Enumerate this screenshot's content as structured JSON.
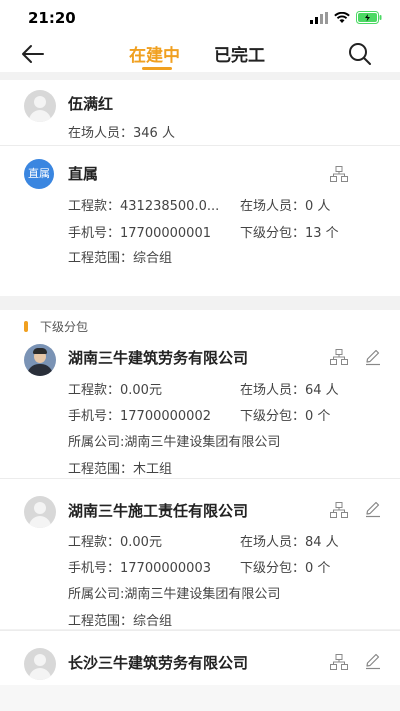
{
  "status_bar": {
    "time": "21:20",
    "icons": [
      "signal-icon",
      "wifi-icon",
      "battery-charging-icon"
    ],
    "battery_color": "#4cd964"
  },
  "nav": {
    "back_icon": "back-arrow-icon",
    "tabs": [
      {
        "label": "在建中",
        "active": true
      },
      {
        "label": "已完工",
        "active": false
      }
    ],
    "search_icon": "search-icon",
    "accent_color": "#f0a020"
  },
  "manager": {
    "name": "伍满红",
    "onsite": "在场人员：346 人"
  },
  "direct": {
    "badge": "直属",
    "name": "直属",
    "amount": "工程款：431238500.0...",
    "onsite": "在场人员：0 人",
    "phone": "手机号：17700000001",
    "subcontract": "下级分包：13 个",
    "scope": "工程范围：综合组"
  },
  "section": {
    "title": "下级分包"
  },
  "subcontractors": [
    {
      "name": "湖南三牛建筑劳务有限公司",
      "amount": "工程款：0.00元",
      "onsite": "在场人员：64 人",
      "phone": "手机号：17700000002",
      "subcontract": "下级分包：0 个",
      "company": "所属公司:湖南三牛建设集团有限公司",
      "scope": "工程范围：木工组"
    },
    {
      "name": "湖南三牛施工责任有限公司",
      "amount": "工程款：0.00元",
      "onsite": "在场人员：84 人",
      "phone": "手机号：17700000003",
      "subcontract": "下级分包：0 个",
      "company": "所属公司:湖南三牛建设集团有限公司",
      "scope": "工程范围：综合组"
    },
    {
      "name": "长沙三牛建筑劳务有限公司"
    }
  ]
}
